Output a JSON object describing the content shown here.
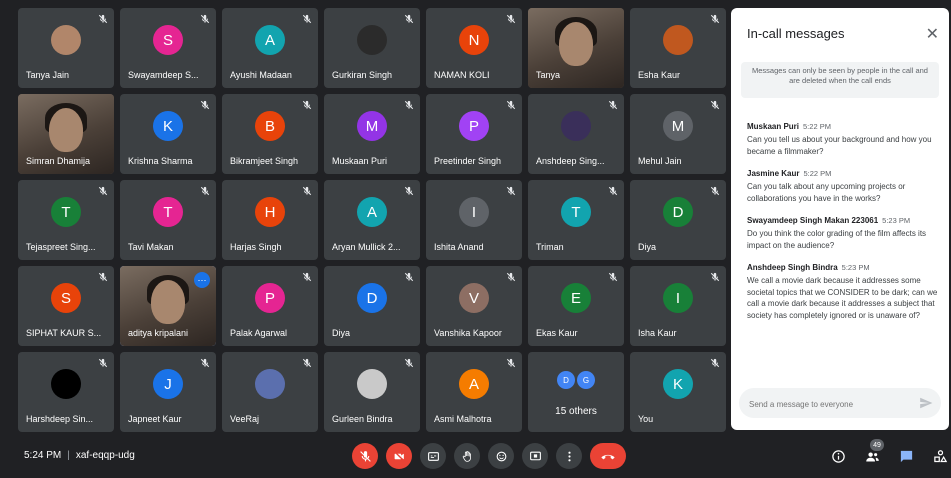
{
  "colors": {
    "tile_bg": "#3c4043",
    "page_bg": "#202124",
    "accent": "#8ab4f8",
    "danger": "#ea4335",
    "chat_accent": "#1a73e8"
  },
  "participants": [
    {
      "name": "Tanya Jain",
      "muted": true,
      "avatar": "photo",
      "color": "#b1866a"
    },
    {
      "name": "Swayamdeep S...",
      "muted": true,
      "initial": "S",
      "color": "#e52592"
    },
    {
      "name": "Ayushi Madaan",
      "muted": true,
      "initial": "A",
      "color": "#12a4af"
    },
    {
      "name": "Gurkiran Singh",
      "muted": true,
      "avatar": "photo",
      "color": "#2b2b2b"
    },
    {
      "name": "NAMAN KOLI",
      "muted": true,
      "initial": "N",
      "color": "#e8430a"
    },
    {
      "name": "Tanya",
      "muted": false,
      "avatar": "video"
    },
    {
      "name": "Esha Kaur",
      "muted": true,
      "avatar": "photo",
      "color": "#c0581f"
    },
    {
      "name": "Simran Dhamija",
      "muted": false,
      "avatar": "video"
    },
    {
      "name": "Krishna Sharma",
      "muted": true,
      "initial": "K",
      "color": "#1a73e8"
    },
    {
      "name": "Bikramjeet Singh",
      "muted": true,
      "initial": "B",
      "color": "#e8430a"
    },
    {
      "name": "Muskaan Puri",
      "muted": true,
      "initial": "M",
      "color": "#9334e6"
    },
    {
      "name": "Preetinder Singh",
      "muted": true,
      "initial": "P",
      "color": "#a142f4"
    },
    {
      "name": "Anshdeep Sing...",
      "muted": true,
      "avatar": "photo",
      "color": "#3a2f5a"
    },
    {
      "name": "Mehul Jain",
      "muted": true,
      "initial": "M",
      "color": "#5f6368"
    },
    {
      "name": "Tejaspreet Sing...",
      "muted": true,
      "initial": "T",
      "color": "#188038"
    },
    {
      "name": "Tavi Makan",
      "muted": true,
      "initial": "T",
      "color": "#e52592"
    },
    {
      "name": "Harjas Singh",
      "muted": true,
      "initial": "H",
      "color": "#e8430a"
    },
    {
      "name": "Aryan Mullick 2...",
      "muted": true,
      "initial": "A",
      "color": "#12a4af"
    },
    {
      "name": "Ishita Anand",
      "muted": true,
      "initial": "I",
      "color": "#5f6368"
    },
    {
      "name": "Triman",
      "muted": true,
      "initial": "T",
      "color": "#12a4af"
    },
    {
      "name": "Diya",
      "muted": true,
      "initial": "D",
      "color": "#188038"
    },
    {
      "name": "SIPHAT KAUR S...",
      "muted": true,
      "initial": "S",
      "color": "#e8430a"
    },
    {
      "name": "aditya kripalani",
      "muted": false,
      "avatar": "video",
      "speaking": true
    },
    {
      "name": "Palak Agarwal",
      "muted": true,
      "initial": "P",
      "color": "#e52592"
    },
    {
      "name": "Diya",
      "muted": true,
      "initial": "D",
      "color": "#1a73e8"
    },
    {
      "name": "Vanshika Kapoor",
      "muted": true,
      "initial": "V",
      "color": "#8d6e63"
    },
    {
      "name": "Ekas Kaur",
      "muted": true,
      "initial": "E",
      "color": "#188038"
    },
    {
      "name": "Isha Kaur",
      "muted": true,
      "initial": "I",
      "color": "#188038"
    },
    {
      "name": "Harshdeep Sin...",
      "muted": true,
      "avatar": "photo",
      "color": "#000000"
    },
    {
      "name": "Japneet Kaur",
      "muted": true,
      "initial": "J",
      "color": "#1a73e8"
    },
    {
      "name": "VeeRaj",
      "muted": true,
      "avatar": "photo",
      "color": "#5b6fae"
    },
    {
      "name": "Gurleen Bindra",
      "muted": true,
      "avatar": "photo",
      "color": "#c9c9c9"
    },
    {
      "name": "Asmi Malhotra",
      "muted": true,
      "initial": "A",
      "color": "#f57c00"
    },
    {
      "name": "15 others",
      "others": true,
      "bubbles": [
        "D",
        "G"
      ]
    },
    {
      "name": "You",
      "muted": true,
      "initial": "K",
      "color": "#12a4af"
    }
  ],
  "chat": {
    "title": "In-call messages",
    "notice": "Messages can only be seen by people in the call and are deleted when the call ends",
    "messages": [
      {
        "sender": "Muskaan Puri",
        "time": "5:22 PM",
        "text": "Can you tell us about your background and how you became a filmmaker?"
      },
      {
        "sender": "Jasmine Kaur",
        "time": "5:22 PM",
        "text": "Can you talk about any upcoming projects or collaborations you have in the works?"
      },
      {
        "sender": "Swayamdeep Singh Makan 223061",
        "time": "5:23 PM",
        "text": "Do you think the color grading of the film affects its impact on the audience?"
      },
      {
        "sender": "Anshdeep Singh Bindra",
        "time": "5:23 PM",
        "text": "We call a movie dark because it addresses some societal topics that we CONSIDER to be dark; can we call a movie dark because it addresses a subject that society has completely ignored or is unaware of?"
      }
    ],
    "input_placeholder": "Send a message to everyone"
  },
  "footer": {
    "time": "5:24 PM",
    "separator": "|",
    "meeting_code": "xaf-eqqp-udg",
    "people_count": "49"
  },
  "icons": {
    "mic": "mic-off-icon",
    "cam": "camera-off-icon",
    "captions": "captions-icon",
    "hand": "raise-hand-icon",
    "emoji": "emoji-icon",
    "present": "present-icon",
    "more": "more-icon",
    "end": "end-call-icon",
    "info": "info-icon",
    "people": "people-icon",
    "chat": "chat-icon",
    "activities": "activities-icon"
  }
}
